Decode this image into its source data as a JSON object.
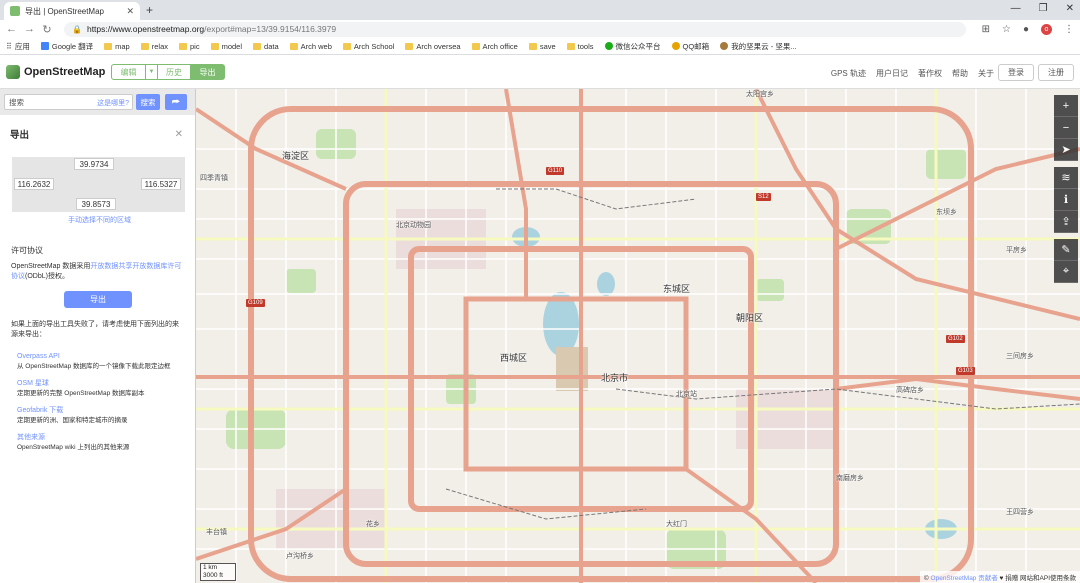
{
  "browser": {
    "tab_title": "导出 | OpenStreetMap",
    "url_host": "https://www.openstreetmap.org",
    "url_path": "/export#map=13/39.9154/116.3979"
  },
  "bookmarks": [
    {
      "label": "应用",
      "icon": "apps-icon"
    },
    {
      "label": "Google 翻译",
      "icon": "google-translate-icon"
    },
    {
      "label": "map",
      "icon": "folder-icon"
    },
    {
      "label": "relax",
      "icon": "folder-icon"
    },
    {
      "label": "pic",
      "icon": "folder-icon"
    },
    {
      "label": "model",
      "icon": "folder-icon"
    },
    {
      "label": "data",
      "icon": "folder-icon"
    },
    {
      "label": "Arch web",
      "icon": "folder-icon"
    },
    {
      "label": "Arch School",
      "icon": "folder-icon"
    },
    {
      "label": "Arch oversea",
      "icon": "folder-icon"
    },
    {
      "label": "Arch office",
      "icon": "folder-icon"
    },
    {
      "label": "save",
      "icon": "folder-icon"
    },
    {
      "label": "tools",
      "icon": "folder-icon"
    },
    {
      "label": "微信公众平台",
      "icon": "wechat-icon"
    },
    {
      "label": "QQ邮箱",
      "icon": "qqmail-icon"
    },
    {
      "label": "我的坚果云 - 坚果...",
      "icon": "nutstore-icon"
    }
  ],
  "header": {
    "logo_text": "OpenStreetMap",
    "edit_label": "编辑",
    "history_label": "历史",
    "export_label": "导出",
    "links": [
      "GPS 轨迹",
      "用户日记",
      "著作权",
      "帮助",
      "关于"
    ],
    "login_label": "登录",
    "register_label": "注册"
  },
  "search": {
    "placeholder": "搜索",
    "where_label": "这是哪里?",
    "go_label": "搜索",
    "directions_icon": "directions-icon"
  },
  "export_panel": {
    "title": "导出",
    "bbox": {
      "north": "39.9734",
      "west": "116.2632",
      "east": "116.5327",
      "south": "39.8573"
    },
    "manual_select": "手动选择不同的区域",
    "license_heading": "许可协议",
    "license_prefix": "OpenStreetMap 数据采用",
    "license_link": "开放数据共享开放数据库许可协议",
    "license_suffix": "(ODbL)授权。",
    "export_button": "导出",
    "fail_text": "如果上面的导出工具失败了，请考虑使用下面列出的来源来导出：",
    "sources": [
      {
        "name": "Overpass API",
        "desc": "从 OpenStreetMap 数据库的一个镜像下载此限定边框"
      },
      {
        "name": "OSM 星球",
        "desc": "定期更新的完整 OpenStreetMap 数据库副本"
      },
      {
        "name": "Geofabrik 下载",
        "desc": "定期更新的洲、国家和特定城市的摘录"
      },
      {
        "name": "其他来源",
        "desc": "OpenStreetMap wiki 上列出的其他来源"
      }
    ]
  },
  "map": {
    "labels": {
      "haidian": "海淀区",
      "sijiqing": "四季青镇",
      "chaoyang": "朝阳区",
      "dongcheng": "东城区",
      "xicheng": "西城区",
      "beijingshi": "北京市",
      "taiyanggong": "太阳宫乡",
      "dongba": "东坝乡",
      "pingfang": "平房乡",
      "sanjianfang": "三间房乡",
      "gaobeidian": "高碑店乡",
      "nanmofang": "南磨房乡",
      "wangsiying": "王四营乡",
      "dahongmen": "大红门",
      "lugouqiao": "卢沟桥乡",
      "huaxiang": "花乡",
      "fengtai": "丰台镇",
      "beijing_zoo": "北京动物园",
      "beijingzhan": "北京站"
    },
    "shields": [
      "G110",
      "G109",
      "G102",
      "G103",
      "S12"
    ],
    "scale_km": "1 km",
    "scale_ft": "3000 ft",
    "attribution_prefix": "©",
    "attribution_link": "OpenStreetMap 贡献者",
    "attribution_suffix": "♥ 捐赠 网站和API使用条款"
  }
}
